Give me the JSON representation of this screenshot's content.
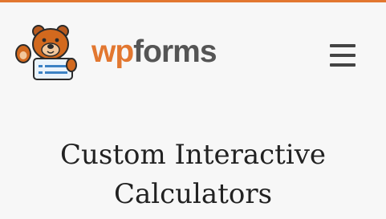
{
  "header": {
    "brand": {
      "part1": "wp",
      "part2": "forms"
    },
    "menu_icon": "hamburger-menu-icon",
    "logo_icon": "wpforms-bear-mascot-icon"
  },
  "main": {
    "title_line1": "Custom Interactive",
    "title_line2": "Calculators"
  },
  "colors": {
    "accent": "#e27730",
    "brand_text": "#555555",
    "title_text": "#222222",
    "background": "#f7f7f7"
  }
}
